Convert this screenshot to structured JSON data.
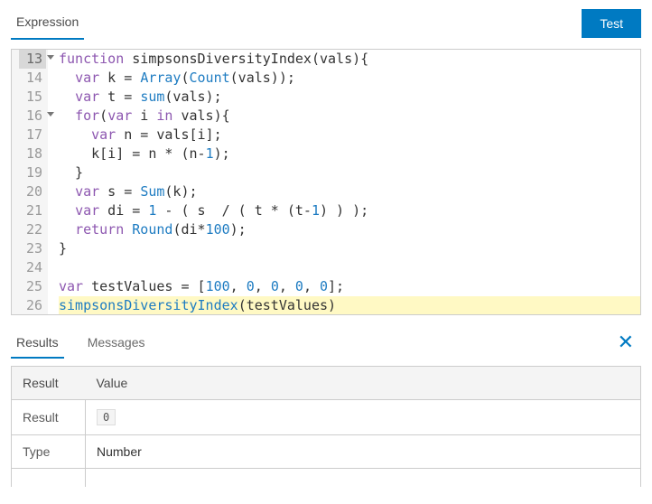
{
  "topTabs": {
    "expression": "Expression"
  },
  "testButton": "Test",
  "code": {
    "startLine": 13,
    "lines": [
      {
        "n": 13,
        "fold": true,
        "hl": false,
        "tokens": [
          [
            "kw",
            "function"
          ],
          [
            "id",
            " simpsonsDiversityIndex(vals){"
          ]
        ]
      },
      {
        "n": 14,
        "fold": false,
        "hl": false,
        "tokens": [
          [
            "id",
            "  "
          ],
          [
            "kw",
            "var"
          ],
          [
            "id",
            " k = "
          ],
          [
            "fn",
            "Array"
          ],
          [
            "id",
            "("
          ],
          [
            "fn",
            "Count"
          ],
          [
            "id",
            "(vals));"
          ]
        ]
      },
      {
        "n": 15,
        "fold": false,
        "hl": false,
        "tokens": [
          [
            "id",
            "  "
          ],
          [
            "kw",
            "var"
          ],
          [
            "id",
            " t = "
          ],
          [
            "fn",
            "sum"
          ],
          [
            "id",
            "(vals);"
          ]
        ]
      },
      {
        "n": 16,
        "fold": true,
        "hl": false,
        "tokens": [
          [
            "id",
            "  "
          ],
          [
            "kw",
            "for"
          ],
          [
            "id",
            "("
          ],
          [
            "kw",
            "var"
          ],
          [
            "id",
            " i "
          ],
          [
            "kw",
            "in"
          ],
          [
            "id",
            " vals){"
          ]
        ]
      },
      {
        "n": 17,
        "fold": false,
        "hl": false,
        "tokens": [
          [
            "id",
            "    "
          ],
          [
            "kw",
            "var"
          ],
          [
            "id",
            " n = vals[i];"
          ]
        ]
      },
      {
        "n": 18,
        "fold": false,
        "hl": false,
        "tokens": [
          [
            "id",
            "    k[i] = n * (n-"
          ],
          [
            "num",
            "1"
          ],
          [
            "id",
            ");"
          ]
        ]
      },
      {
        "n": 19,
        "fold": false,
        "hl": false,
        "tokens": [
          [
            "id",
            "  }"
          ]
        ]
      },
      {
        "n": 20,
        "fold": false,
        "hl": false,
        "tokens": [
          [
            "id",
            "  "
          ],
          [
            "kw",
            "var"
          ],
          [
            "id",
            " s = "
          ],
          [
            "fn",
            "Sum"
          ],
          [
            "id",
            "(k);"
          ]
        ]
      },
      {
        "n": 21,
        "fold": false,
        "hl": false,
        "tokens": [
          [
            "id",
            "  "
          ],
          [
            "kw",
            "var"
          ],
          [
            "id",
            " di = "
          ],
          [
            "num",
            "1"
          ],
          [
            "id",
            " - ( s  / ( t * (t-"
          ],
          [
            "num",
            "1"
          ],
          [
            "id",
            ") ) );"
          ]
        ]
      },
      {
        "n": 22,
        "fold": false,
        "hl": false,
        "tokens": [
          [
            "id",
            "  "
          ],
          [
            "kw",
            "return"
          ],
          [
            "id",
            " "
          ],
          [
            "fn",
            "Round"
          ],
          [
            "id",
            "(di*"
          ],
          [
            "num",
            "100"
          ],
          [
            "id",
            ");"
          ]
        ]
      },
      {
        "n": 23,
        "fold": false,
        "hl": false,
        "tokens": [
          [
            "id",
            "}"
          ]
        ]
      },
      {
        "n": 24,
        "fold": false,
        "hl": false,
        "tokens": [
          [
            "id",
            ""
          ]
        ]
      },
      {
        "n": 25,
        "fold": false,
        "hl": false,
        "tokens": [
          [
            "kw",
            "var"
          ],
          [
            "id",
            " testValues = ["
          ],
          [
            "num",
            "100"
          ],
          [
            "id",
            ", "
          ],
          [
            "num",
            "0"
          ],
          [
            "id",
            ", "
          ],
          [
            "num",
            "0"
          ],
          [
            "id",
            ", "
          ],
          [
            "num",
            "0"
          ],
          [
            "id",
            ", "
          ],
          [
            "num",
            "0"
          ],
          [
            "id",
            "];"
          ]
        ]
      },
      {
        "n": 26,
        "fold": false,
        "hl": true,
        "tokens": [
          [
            "blueid",
            "simpsonsDiversityIndex"
          ],
          [
            "id",
            "(testValues)"
          ]
        ]
      }
    ]
  },
  "resultsTabs": {
    "results": "Results",
    "messages": "Messages"
  },
  "resultsHeaders": {
    "key": "Result",
    "value": "Value"
  },
  "resultsRows": [
    {
      "key": "Result",
      "value": "0",
      "boxed": true
    },
    {
      "key": "Type",
      "value": "Number",
      "boxed": false
    }
  ]
}
